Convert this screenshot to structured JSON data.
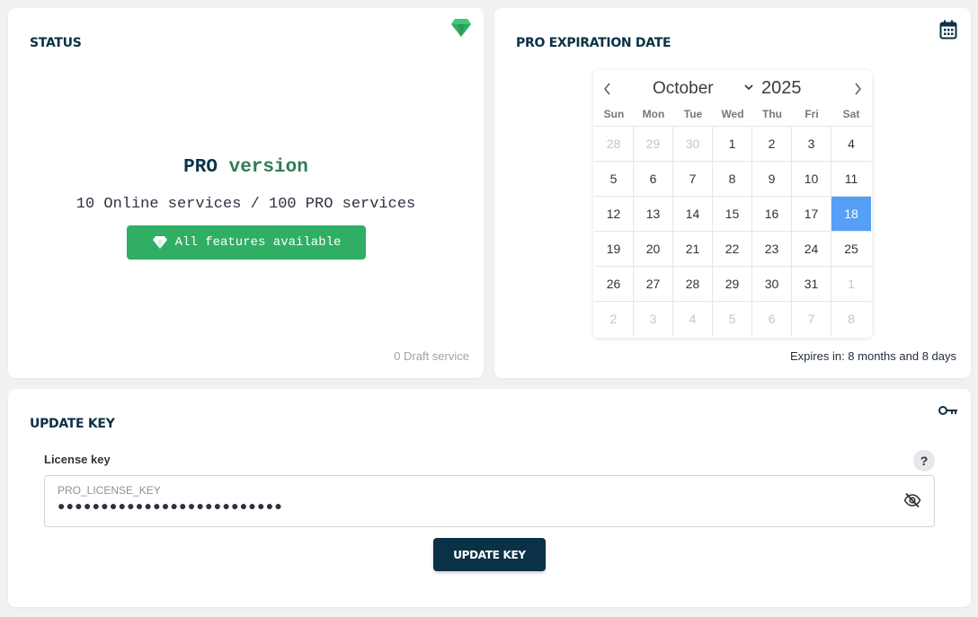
{
  "status": {
    "title": "STATUS",
    "pro_word": "PRO",
    "version_word": "version",
    "services_line": "10 Online services / 100 PRO services",
    "features_label": "All features available",
    "draft_text": "0 Draft service"
  },
  "expiry": {
    "title": "PRO EXPIRATION DATE",
    "calendar": {
      "month": "October",
      "year": "2025",
      "weekdays": [
        "Sun",
        "Mon",
        "Tue",
        "Wed",
        "Thu",
        "Fri",
        "Sat"
      ],
      "days": [
        [
          "28",
          "29",
          "30",
          "1",
          "2",
          "3",
          "4"
        ],
        [
          "5",
          "6",
          "7",
          "8",
          "9",
          "10",
          "11"
        ],
        [
          "12",
          "13",
          "14",
          "15",
          "16",
          "17",
          "18"
        ],
        [
          "19",
          "20",
          "21",
          "22",
          "23",
          "24",
          "25"
        ],
        [
          "26",
          "27",
          "28",
          "29",
          "30",
          "31",
          "1"
        ],
        [
          "2",
          "3",
          "4",
          "5",
          "6",
          "7",
          "8"
        ]
      ],
      "selected_day": "18"
    },
    "expires_text": "Expires in: 8 months and 8 days"
  },
  "update_key": {
    "title": "UPDATE KEY",
    "license_label": "License key",
    "help_label": "?",
    "placeholder": "PRO_LICENSE_KEY",
    "masked_value": "●●●●●●●●●●●●●●●●●●●●●●●●●●",
    "button_label": "UPDATE KEY"
  },
  "colors": {
    "navy": "#0b3146",
    "green": "#2fae64",
    "selected_blue": "#569ff7"
  }
}
